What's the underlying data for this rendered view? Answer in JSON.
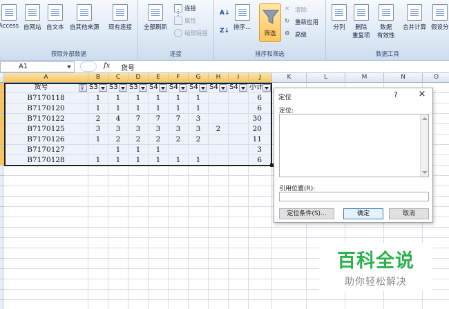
{
  "ribbon": {
    "groups": {
      "external": "获取外部数据",
      "connections": "连接",
      "sort_filter": "排序和筛选",
      "data_tools": "数据工具"
    },
    "buttons": {
      "access": "Access",
      "web": "自网站",
      "text": "自文本",
      "other": "自其他来源",
      "existing": "现有连接",
      "refresh_all": "全部刷新",
      "connections": "连接",
      "properties": "属性",
      "edit_links": "编辑链接",
      "sort": "排序...",
      "filter": "筛选",
      "clear": "清除",
      "reapply": "重新应用",
      "advanced": "高级",
      "text_to_cols": "分列",
      "remove_dup_1": "删除",
      "remove_dup_2": "重复项",
      "validation_1": "数据",
      "validation_2": "有效性",
      "consolidate": "合并计算",
      "whatif": "假设分"
    }
  },
  "formula_bar": {
    "name_box": "A1",
    "fx": "fx",
    "content": "货号"
  },
  "grid": {
    "columns": [
      "A",
      "B",
      "C",
      "D",
      "E",
      "F",
      "G",
      "H",
      "I",
      "J",
      "K",
      "L",
      "M",
      "N",
      "O"
    ],
    "header_row": [
      "货号",
      "S3",
      "S3",
      "S3",
      "S4",
      "S4",
      "S4",
      "S4",
      "S4",
      "小计"
    ],
    "rows": [
      [
        "B7170118",
        "1",
        "1",
        "1",
        "1",
        "1",
        "1",
        "",
        "",
        "6"
      ],
      [
        "B7170120",
        "1",
        "1",
        "1",
        "1",
        "1",
        "1",
        "",
        "",
        "6"
      ],
      [
        "B7170122",
        "2",
        "4",
        "7",
        "7",
        "7",
        "3",
        "",
        "",
        "30"
      ],
      [
        "B7170125",
        "3",
        "3",
        "3",
        "3",
        "3",
        "3",
        "2",
        "",
        "20"
      ],
      [
        "B7170126",
        "1",
        "2",
        "2",
        "2",
        "2",
        "2",
        "",
        "",
        "11"
      ],
      [
        "B7170127",
        "",
        "1",
        "1",
        "1",
        "",
        "",
        "",
        "",
        "3"
      ],
      [
        "B7170128",
        "1",
        "1",
        "1",
        "1",
        "1",
        "1",
        "",
        "",
        "6"
      ]
    ]
  },
  "dialog": {
    "title": "定位",
    "help": "?",
    "close": "×",
    "goto_label": "定位:",
    "reference_label": "引用位置(R):",
    "special_button": "定位条件(S)...",
    "ok_button": "确定",
    "cancel_button": "取消"
  },
  "watermark": {
    "main": "百科全说",
    "sub": "助你轻松解决"
  },
  "colors": {
    "accent": "#f7c55f",
    "ribbon": "#dfe9f5",
    "watermark": "#2bb24c"
  }
}
